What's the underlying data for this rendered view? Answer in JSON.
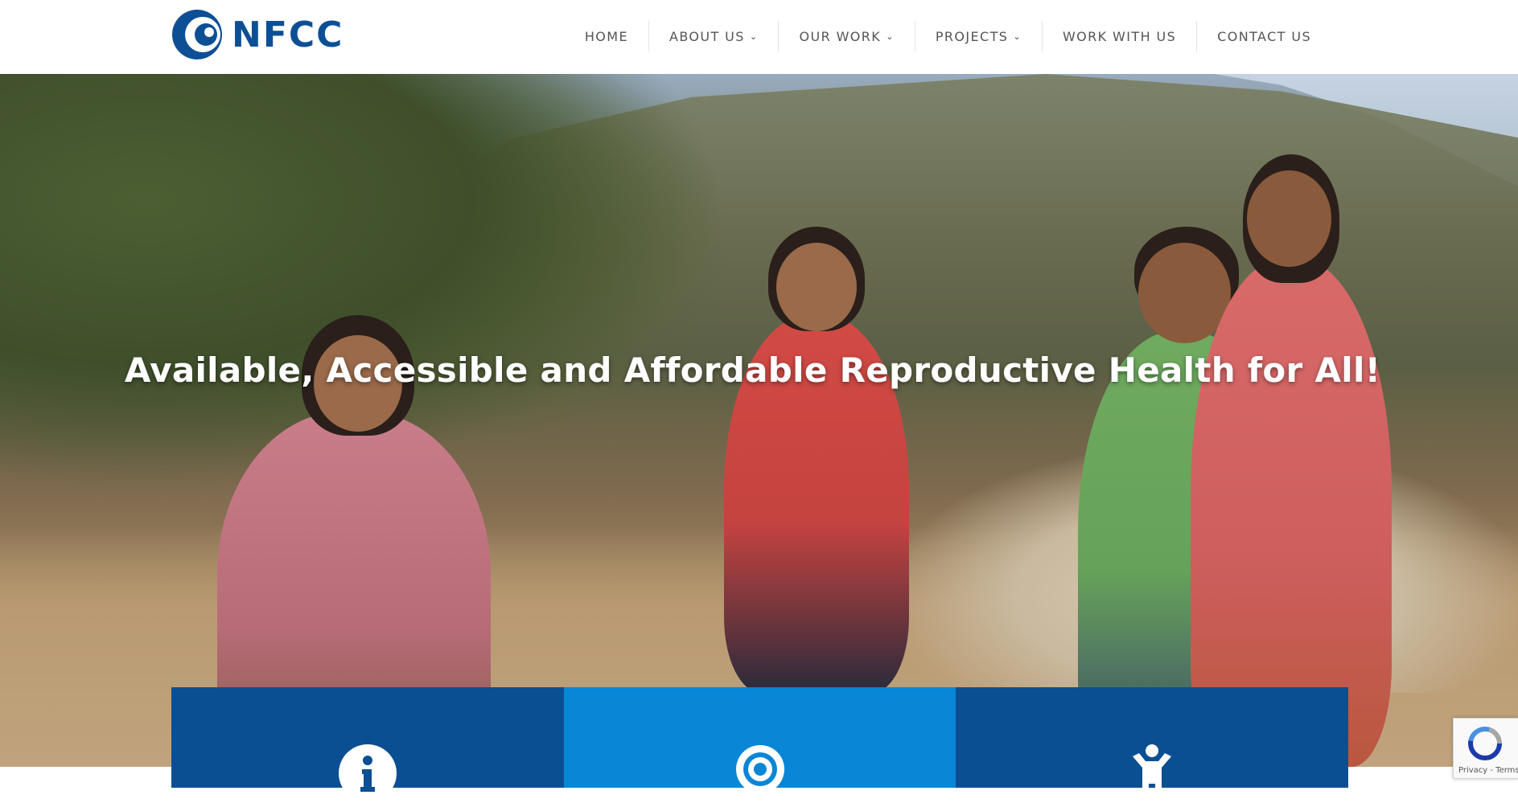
{
  "brand": {
    "name": "NFCC",
    "color": "#0d4f95"
  },
  "nav": {
    "items": [
      {
        "label": "HOME",
        "has_dropdown": false
      },
      {
        "label": "ABOUT US",
        "has_dropdown": true
      },
      {
        "label": "OUR WORK",
        "has_dropdown": true
      },
      {
        "label": "PROJECTS",
        "has_dropdown": true
      },
      {
        "label": "WORK WITH US",
        "has_dropdown": false
      },
      {
        "label": "CONTACT US",
        "has_dropdown": false
      }
    ]
  },
  "hero": {
    "headline": "Available, Accessible and Affordable Reproductive Health for All!"
  },
  "features": [
    {
      "icon": "info-circle-icon",
      "color": "#0b4f93"
    },
    {
      "icon": "target-icon",
      "color": "#0986d6"
    },
    {
      "icon": "child-icon",
      "color": "#0b4f93"
    }
  ],
  "recaptcha": {
    "links": "Privacy - Terms"
  }
}
